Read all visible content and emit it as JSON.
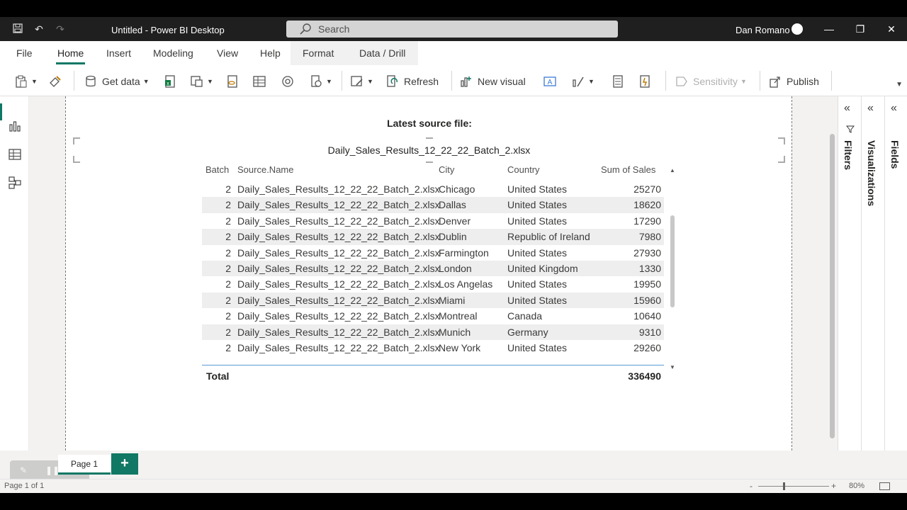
{
  "window": {
    "title": "Untitled - Power BI Desktop",
    "search_placeholder": "Search",
    "user_name": "Dan Romano"
  },
  "tabs": [
    "File",
    "Home",
    "Insert",
    "Modeling",
    "View",
    "Help",
    "Format",
    "Data / Drill"
  ],
  "ribbon": {
    "get_data": "Get data",
    "refresh": "Refresh",
    "new_visual": "New visual",
    "sensitivity": "Sensitivity",
    "publish": "Publish"
  },
  "panes": {
    "filters": "Filters",
    "visualizations": "Visualizations",
    "fields": "Fields"
  },
  "report": {
    "card_title": "Latest source file:",
    "card_value": "Daily_Sales_Results_12_22_22_Batch_2.xlsx",
    "table": {
      "columns": [
        "Batch",
        "Source.Name",
        "City",
        "Country",
        "Sum of Sales"
      ],
      "rows": [
        [
          "2",
          "Daily_Sales_Results_12_22_22_Batch_2.xlsx",
          "Chicago",
          "United States",
          "25270"
        ],
        [
          "2",
          "Daily_Sales_Results_12_22_22_Batch_2.xlsx",
          "Dallas",
          "United States",
          "18620"
        ],
        [
          "2",
          "Daily_Sales_Results_12_22_22_Batch_2.xlsx",
          "Denver",
          "United States",
          "17290"
        ],
        [
          "2",
          "Daily_Sales_Results_12_22_22_Batch_2.xlsx",
          "Dublin",
          "Republic of Ireland",
          "7980"
        ],
        [
          "2",
          "Daily_Sales_Results_12_22_22_Batch_2.xlsx",
          "Farmington",
          "United States",
          "27930"
        ],
        [
          "2",
          "Daily_Sales_Results_12_22_22_Batch_2.xlsx",
          "London",
          "United Kingdom",
          "1330"
        ],
        [
          "2",
          "Daily_Sales_Results_12_22_22_Batch_2.xlsx",
          "Los Angelas",
          "United States",
          "19950"
        ],
        [
          "2",
          "Daily_Sales_Results_12_22_22_Batch_2.xlsx",
          "Miami",
          "United States",
          "15960"
        ],
        [
          "2",
          "Daily_Sales_Results_12_22_22_Batch_2.xlsx",
          "Montreal",
          "Canada",
          "10640"
        ],
        [
          "2",
          "Daily_Sales_Results_12_22_22_Batch_2.xlsx",
          "Munich",
          "Germany",
          "9310"
        ],
        [
          "2",
          "Daily_Sales_Results_12_22_22_Batch_2.xlsx",
          "New York",
          "United States",
          "29260"
        ]
      ],
      "total_label": "Total",
      "total_value": "336490"
    }
  },
  "page_tabs": {
    "page_1": "Page 1",
    "add": "+"
  },
  "status": {
    "page_info": "Page 1 of 1",
    "zoom": "80%",
    "zoom_minus": "-",
    "zoom_plus": "+"
  },
  "colors": {
    "accent": "#117865",
    "titlebar": "#1f1f1f",
    "selection": "#5b9bd5"
  }
}
